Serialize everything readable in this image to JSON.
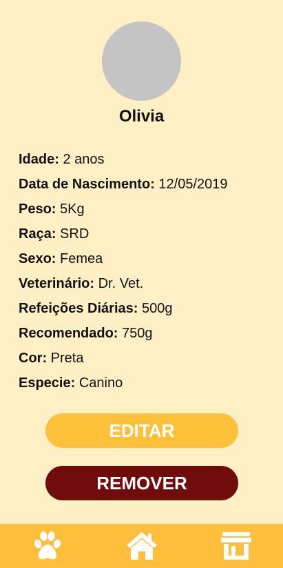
{
  "pet": {
    "name": "Olivia"
  },
  "details": [
    {
      "label": "Idade:",
      "value": "2 anos"
    },
    {
      "label": "Data de Nascimento:",
      "value": "12/05/2019"
    },
    {
      "label": "Peso:",
      "value": "5Kg"
    },
    {
      "label": "Raça:",
      "value": "SRD"
    },
    {
      "label": "Sexo:",
      "value": "Femea"
    },
    {
      "label": "Veterinário:",
      "value": "Dr. Vet."
    },
    {
      "label": "Refeições Diárias:",
      "value": "500g"
    },
    {
      "label": "Recomendado:",
      "value": "750g"
    },
    {
      "label": "Cor:",
      "value": "Preta"
    },
    {
      "label": "Especie:",
      "value": "Canino"
    }
  ],
  "actions": {
    "edit_label": "EDITAR",
    "remove_label": "REMOVER"
  },
  "nav": {
    "items": [
      {
        "icon": "paw-icon"
      },
      {
        "icon": "home-icon"
      },
      {
        "icon": "store-icon"
      }
    ]
  },
  "colors": {
    "background": "#FFEFC4",
    "accent": "#FFC03A",
    "danger": "#710C0C",
    "nav_bar": "#FFBE3B",
    "avatar_placeholder": "#C4C4C4"
  }
}
